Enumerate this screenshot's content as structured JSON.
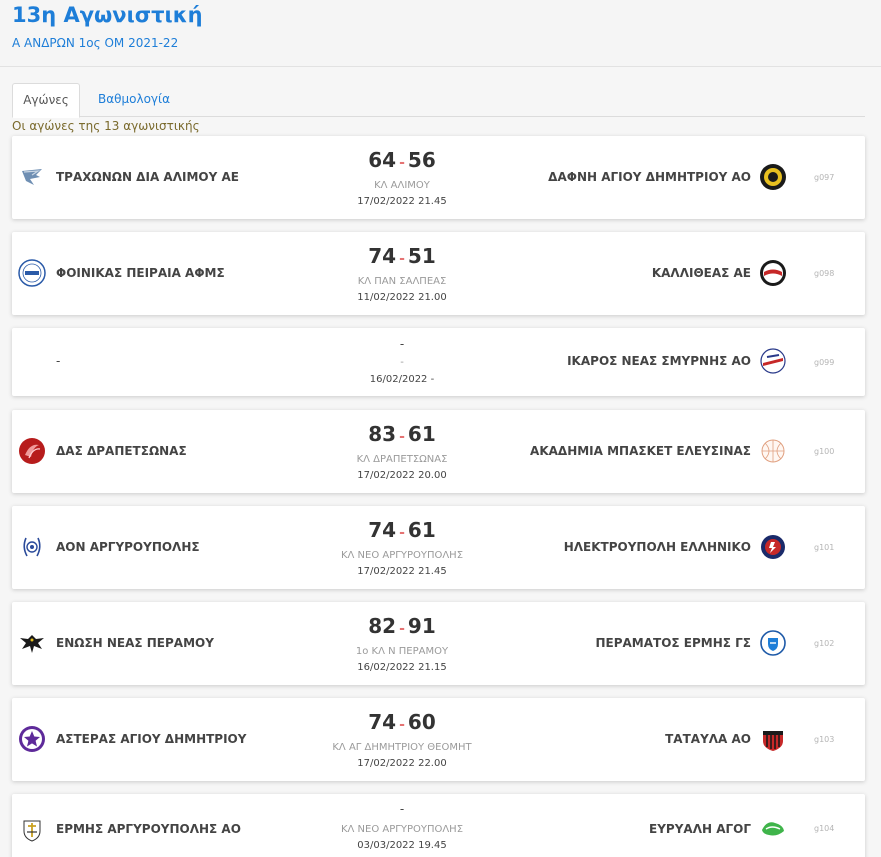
{
  "header": {
    "title": "13η Αγωνιστική",
    "subtitle": "Α ΑΝΔΡΩΝ 1ος ΟΜ 2021-22"
  },
  "tabs": [
    {
      "label": "Αγώνες",
      "active": true
    },
    {
      "label": "Βαθμολογία",
      "active": false
    }
  ],
  "caption": "Οι αγώνες της 13 αγωνιστικής",
  "colors": {
    "accent": "#1e7ed8",
    "score_separator": "#e57373"
  },
  "games": [
    {
      "home": "ΤΡΑΧΩΝΩΝ ΔΙΑ ΑΛΙΜΟΥ ΑΕ",
      "home_icon": "bird-crest-icon",
      "away": "ΔΑΦΝΗ ΑΓΙΟΥ ΔΗΜΗΤΡΙΟΥ ΑΟ",
      "away_icon": "black-yellow-crest-icon",
      "home_score": "64",
      "sep": "-",
      "away_score": "56",
      "venue": "ΚΛ ΑΛΙΜΟΥ",
      "datetime": "17/02/2022 21.45",
      "code": "g097"
    },
    {
      "home": "ΦΟΙΝΙΚΑΣ ΠΕΙΡΑΙΑ ΑΦΜΣ",
      "home_icon": "phoenix-1949-crest-icon",
      "away": "ΚΑΛΛΙΘΕΑΣ ΑΕ",
      "away_icon": "red-white-crest-icon",
      "home_score": "74",
      "sep": "-",
      "away_score": "51",
      "venue": "ΚΛ ΠΑΝ ΣΑΛΠΕΑΣ",
      "datetime": "11/02/2022 21.00",
      "code": "g098"
    },
    {
      "home": "-",
      "away": "ΙΚΑΡΟΣ ΝΕΑΣ ΣΜΥΡΝΗΣ ΑΟ",
      "away_icon": "ikaros-crest-icon",
      "home_score": "",
      "sep": "-",
      "away_score": "",
      "venue": "-",
      "datetime": "16/02/2022 -",
      "code": "g099"
    },
    {
      "home": "ΔΑΣ ΔΡΑΠΕΤΣΩΝΑΣ",
      "home_icon": "red-wave-crest-icon",
      "away": "ΑΚΑΔΗΜΙΑ ΜΠΑΣΚΕΤ ΕΛΕΥΣΙΝΑΣ",
      "away_icon": "basketball-crest-icon",
      "home_score": "83",
      "sep": "-",
      "away_score": "61",
      "venue": "ΚΛ ΔΡΑΠΕΤΣΩΝΑΣ",
      "datetime": "17/02/2022 20.00",
      "code": "g100"
    },
    {
      "home": "ΑΟΝ ΑΡΓΥΡΟΥΠΟΛΗΣ",
      "home_icon": "blue-laurel-crest-icon",
      "away": "ΗΛΕΚΤΡΟΥΠΟΛΗ ΕΛΛΗΝΙΚΟ",
      "away_icon": "red-blue-crest-icon",
      "home_score": "74",
      "sep": "-",
      "away_score": "61",
      "venue": "ΚΛ ΝΕΟ ΑΡΓΥΡΟΥΠΟΛΗΣ",
      "datetime": "17/02/2022 21.45",
      "code": "g101"
    },
    {
      "home": "ΕΝΩΣΗ ΝΕΑΣ ΠΕΡΑΜΟΥ",
      "home_icon": "eagle-crest-icon",
      "away": "ΠΕΡΑΜΑΤΟΣ ΕΡΜΗΣ ΓΣ",
      "away_icon": "blue-shield-crest-icon",
      "home_score": "82",
      "sep": "-",
      "away_score": "91",
      "venue": "1ο ΚΛ Ν ΠΕΡΑΜΟΥ",
      "datetime": "16/02/2022 21.15",
      "code": "g102"
    },
    {
      "home": "ΑΣΤΕΡΑΣ ΑΓΙΟΥ ΔΗΜΗΤΡΙΟΥ",
      "home_icon": "purple-star-crest-icon",
      "away": "ΤΑΤΑΥΛΑ ΑΟ",
      "away_icon": "red-black-stripes-crest-icon",
      "home_score": "74",
      "sep": "-",
      "away_score": "60",
      "venue": "ΚΛ ΑΓ ΔΗΜΗΤΡΙΟΥ ΘΕΟΜΗΤ",
      "datetime": "17/02/2022 22.00",
      "code": "g103"
    },
    {
      "home": "ΕΡΜΗΣ ΑΡΓΥΡΟΥΠΟΛΗΣ ΑΟ",
      "home_icon": "hermes-crest-icon",
      "away": "ΕΥΡΥΑΛΗ ΑΓΟΓ",
      "away_icon": "green-crest-icon",
      "home_score": "",
      "sep": "-",
      "away_score": "",
      "venue": "ΚΛ ΝΕΟ ΑΡΓΥΡΟΥΠΟΛΗΣ",
      "datetime": "03/03/2022 19.45",
      "code": "g104"
    }
  ]
}
